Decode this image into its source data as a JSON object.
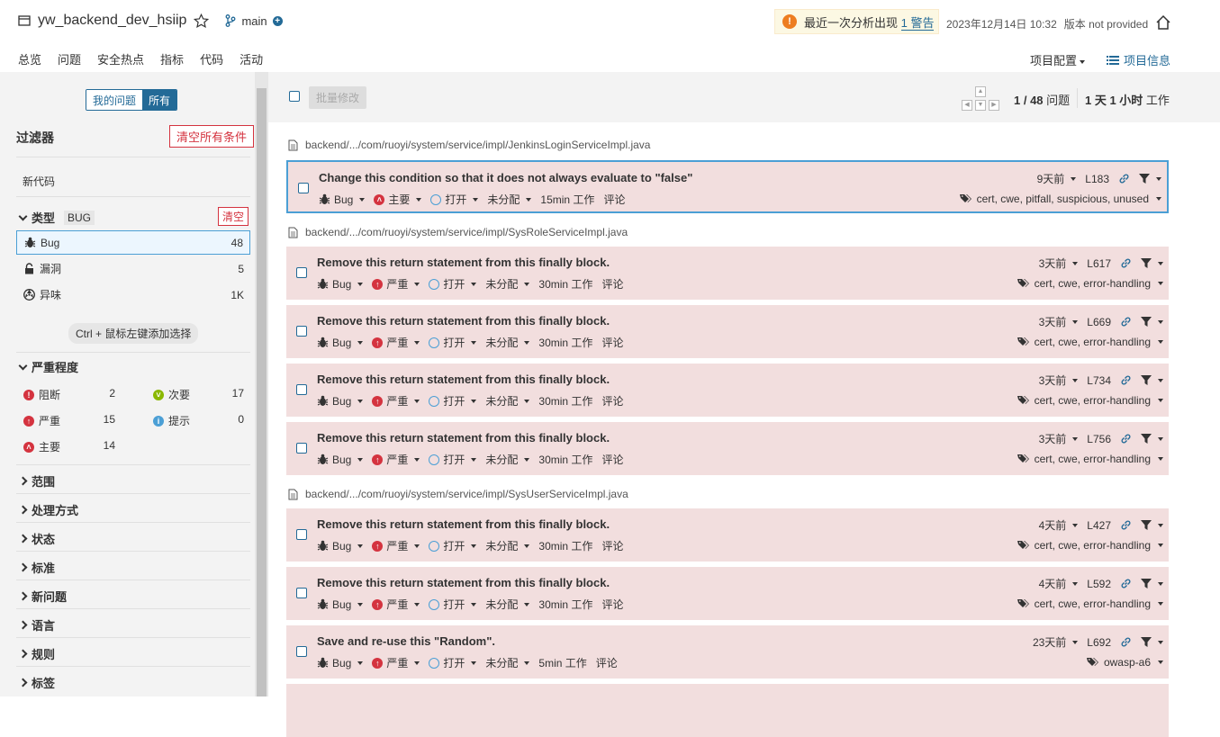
{
  "project": {
    "name": "yw_backend_dev_hsiip",
    "branch": "main"
  },
  "warning": {
    "text": "最近一次分析出现",
    "link": "1 警告"
  },
  "meta": {
    "date": "2023年12月14日 10:32",
    "version": "版本 not provided"
  },
  "nav": {
    "tabs": [
      "总览",
      "问题",
      "安全热点",
      "指标",
      "代码",
      "活动"
    ],
    "active": 1,
    "config": "项目配置",
    "info": "项目信息"
  },
  "sidebar": {
    "my_issues": "我的问题",
    "all": "所有",
    "filters_title": "过滤器",
    "clear_all": "清空所有条件",
    "new_code": "新代码",
    "type": {
      "title": "类型",
      "tag": "BUG",
      "clear": "清空",
      "items": [
        {
          "label": "Bug",
          "count": "48"
        },
        {
          "label": "漏洞",
          "count": "5"
        },
        {
          "label": "异味",
          "count": "1K"
        }
      ]
    },
    "hint": "Ctrl + 鼠标左键添加选择",
    "severity": {
      "title": "严重程度",
      "items": [
        {
          "label": "阻断",
          "count": "2",
          "color": "#d4333f"
        },
        {
          "label": "次要",
          "count": "17",
          "color": "#8ab800"
        },
        {
          "label": "严重",
          "count": "15",
          "color": "#d4333f"
        },
        {
          "label": "提示",
          "count": "0",
          "color": "#4b9fd5"
        },
        {
          "label": "主要",
          "count": "14",
          "color": "#d4333f"
        }
      ]
    },
    "facets": [
      "范围",
      "处理方式",
      "状态",
      "标准",
      "新问题",
      "语言",
      "规则",
      "标签"
    ]
  },
  "toolbar": {
    "bulk": "批量修改",
    "count": "1 / 48",
    "count_suffix": "问题",
    "effort": "1 天 1 小时",
    "effort_suffix": "工作"
  },
  "files": [
    "backend/.../com/ruoyi/system/service/impl/JenkinsLoginServiceImpl.java",
    "backend/.../com/ruoyi/system/service/impl/SysRoleServiceImpl.java",
    "backend/.../com/ruoyi/system/service/impl/SysUserServiceImpl.java"
  ],
  "issues": [
    {
      "msg": "Change this condition so that it does not always evaluate to \"false\"",
      "type": "Bug",
      "severity": "主要",
      "status": "打开",
      "assignee": "未分配",
      "effort": "15min 工作",
      "comment": "评论",
      "age": "9天前",
      "line": "L183",
      "tags": "cert, cwe, pitfall, suspicious, unused"
    },
    {
      "msg": "Remove this return statement from this finally block.",
      "type": "Bug",
      "severity": "严重",
      "status": "打开",
      "assignee": "未分配",
      "effort": "30min 工作",
      "comment": "评论",
      "age": "3天前",
      "line": "L617",
      "tags": "cert, cwe, error-handling"
    },
    {
      "msg": "Remove this return statement from this finally block.",
      "type": "Bug",
      "severity": "严重",
      "status": "打开",
      "assignee": "未分配",
      "effort": "30min 工作",
      "comment": "评论",
      "age": "3天前",
      "line": "L669",
      "tags": "cert, cwe, error-handling"
    },
    {
      "msg": "Remove this return statement from this finally block.",
      "type": "Bug",
      "severity": "严重",
      "status": "打开",
      "assignee": "未分配",
      "effort": "30min 工作",
      "comment": "评论",
      "age": "3天前",
      "line": "L734",
      "tags": "cert, cwe, error-handling"
    },
    {
      "msg": "Remove this return statement from this finally block.",
      "type": "Bug",
      "severity": "严重",
      "status": "打开",
      "assignee": "未分配",
      "effort": "30min 工作",
      "comment": "评论",
      "age": "3天前",
      "line": "L756",
      "tags": "cert, cwe, error-handling"
    },
    {
      "msg": "Remove this return statement from this finally block.",
      "type": "Bug",
      "severity": "严重",
      "status": "打开",
      "assignee": "未分配",
      "effort": "30min 工作",
      "comment": "评论",
      "age": "4天前",
      "line": "L427",
      "tags": "cert, cwe, error-handling"
    },
    {
      "msg": "Remove this return statement from this finally block.",
      "type": "Bug",
      "severity": "严重",
      "status": "打开",
      "assignee": "未分配",
      "effort": "30min 工作",
      "comment": "评论",
      "age": "4天前",
      "line": "L592",
      "tags": "cert, cwe, error-handling"
    },
    {
      "msg": "Save and re-use this \"Random\".",
      "type": "Bug",
      "severity": "严重",
      "status": "打开",
      "assignee": "未分配",
      "effort": "5min 工作",
      "comment": "评论",
      "age": "23天前",
      "line": "L692",
      "tags": "owasp-a6"
    }
  ]
}
